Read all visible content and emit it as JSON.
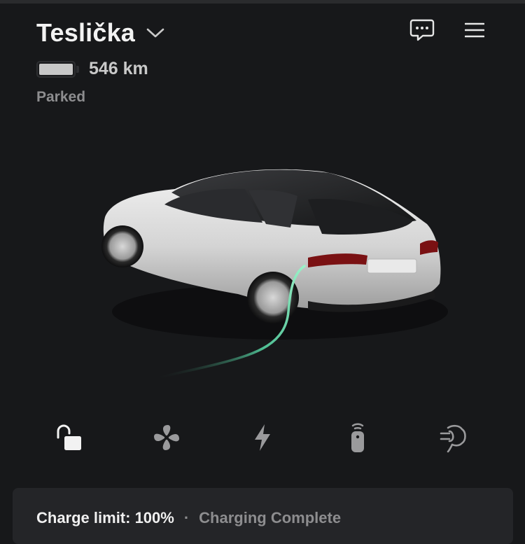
{
  "vehicle": {
    "name": "Teslička",
    "range": "546 km",
    "status": "Parked",
    "battery_level": 1.0
  },
  "header_icons": {
    "messages": "chat-icon",
    "menu": "hamburger-menu-icon",
    "vehicle_selector": "chevron-down-icon"
  },
  "controls": [
    {
      "name": "lock-icon",
      "label": "Lock"
    },
    {
      "name": "fan-icon",
      "label": "Climate"
    },
    {
      "name": "lightning-icon",
      "label": "Charging"
    },
    {
      "name": "remote-key-icon",
      "label": "Controls"
    },
    {
      "name": "summon-icon",
      "label": "Summon"
    }
  ],
  "charge_card": {
    "limit": "Charge limit: 100%",
    "separator": "·",
    "status": "Charging Complete"
  },
  "colors": {
    "background": "#17181a",
    "card": "#242528",
    "charge_cable": "#6ee7b7"
  }
}
